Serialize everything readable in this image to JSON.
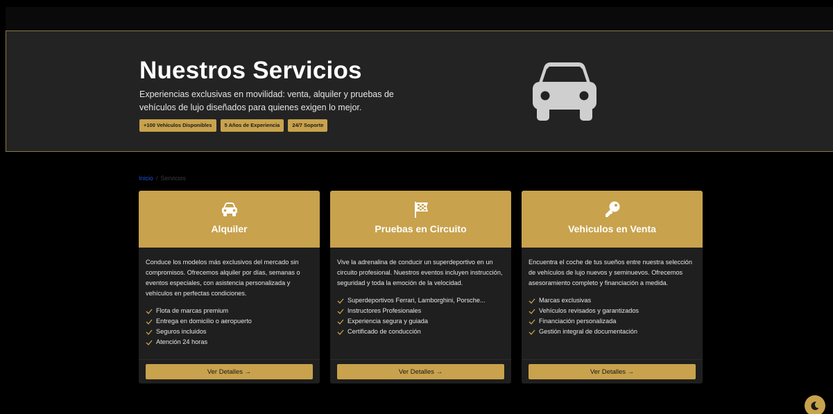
{
  "hero": {
    "title": "Nuestros Servicios",
    "description": "Experiencias exclusivas en movilidad: venta, alquiler y pruebas de vehículos de lujo diseñados para quienes exigen lo mejor.",
    "badges": [
      "+100 Vehículos Disponibles",
      "5 Años de Experiencia",
      "24/7 Soporte"
    ],
    "icon": "car-icon"
  },
  "breadcrumb": {
    "home": "Inicio",
    "separator": "/",
    "current": "Servicios"
  },
  "cards": [
    {
      "icon": "car-icon",
      "title": "Alquiler",
      "description": "Conduce los modelos más exclusivos del mercado sin compromisos. Ofrecemos alquiler por días, semanas o eventos especiales, con asistencia personalizada y vehículos en perfectas condiciones.",
      "features": [
        "Flota de marcas premium",
        "Entrega en domicilio o aeropuerto",
        "Seguros incluidos",
        "Atención 24 horas"
      ],
      "button": "Ver Detalles →"
    },
    {
      "icon": "checkered-flag-icon",
      "title": "Pruebas en Circuito",
      "description": "Vive la adrenalina de conducir un superdeportivo en un circuito profesional. Nuestros eventos incluyen instrucción, seguridad y toda la emoción de la velocidad.",
      "features": [
        "Superdeportivos Ferrari, Lamborghini, Porsche...",
        "Instructores Profesionales",
        "Experiencia segura y guiada",
        "Certificado de conducción"
      ],
      "button": "Ver Detalles →"
    },
    {
      "icon": "key-icon",
      "title": "Vehiculos en Venta",
      "description": "Encuentra el coche de tus sueños entre nuestra selección de vehículos de lujo nuevos y seminuevos. Ofrecemos asesoramiento completo y financiación a medida.",
      "features": [
        "Marcas exclusivas",
        "Vehículos revisados y garantizados",
        "Financiación personalizada",
        "Gestión integral de documentación"
      ],
      "button": "Ver Detalles →"
    }
  ],
  "theme_toggle": {
    "icon": "moon-icon"
  },
  "colors": {
    "accent": "#c8a24c",
    "background": "#000000",
    "hero_background": "#232323",
    "card_background": "#1f1f1f",
    "check": "#c8a24c",
    "link": "#1a4fd6"
  }
}
